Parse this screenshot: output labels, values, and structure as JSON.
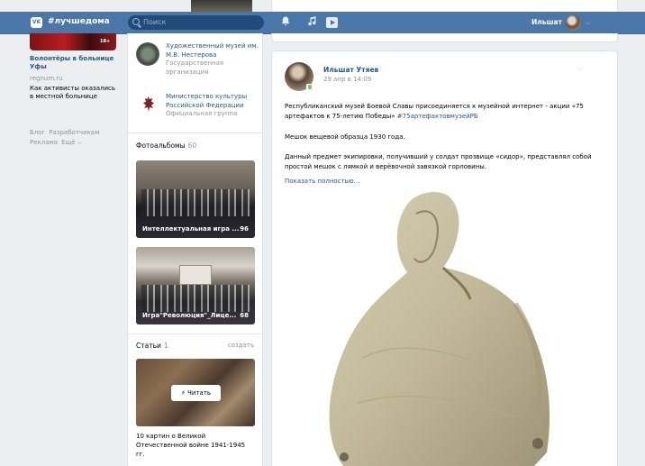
{
  "topbar": {
    "logo": "VK",
    "hashtag": "#лучшедома",
    "search_placeholder": "Поиск",
    "user_name": "Ильшат",
    "bell_icon": "bell-icon",
    "music_icon": "music-note-icon",
    "video_icon": "play-icon"
  },
  "left": {
    "badge": "18+",
    "ad_title": "Волонтёры в больнице Уфы",
    "ad_domain": "regnum.ru",
    "ad_desc": "Как активисты оказались в местной больнице",
    "footer": [
      "Блог",
      "Разработчикам",
      "Реклама",
      "Ещё ⌵"
    ]
  },
  "middle": {
    "groups": [
      {
        "name": "Художественный музей им. М.В. Нестерова",
        "sub": "Государственная организация"
      },
      {
        "name": "Министерство культуры Российской Федерации",
        "sub": "Официальная группа"
      }
    ],
    "albums_title": "Фотоальбомы",
    "albums_count": "60",
    "albums": [
      {
        "caption": "Интеллектуальная игра ...",
        "count": "96"
      },
      {
        "caption": "Игра\"Революция\"_Лице...",
        "count": "68"
      }
    ],
    "articles_title": "Статьи",
    "articles_count": "1",
    "articles_create": "создать",
    "read_button": "⚡ Читать",
    "article_title": "10 картин о Великой Отечественной войне 1941-1945 гг."
  },
  "post": {
    "author": "Ильшат Утяев",
    "date": "29 апр в 14:09",
    "p1": "Республиканский музей Боевой Славы присоединяется к музейной интернет - акции «75 артефактов к 75-летию Победы»",
    "p1_tag": "#75артефактовмузейРБ",
    "p2": "Мешок вещевой образца 1930 года.",
    "p3": "Данный предмет экипировки, получивший у солдат прозвище «сидор», представлял собой простой мешок с лямкой и верёвочной завязкой горловины.",
    "more": "Показать полностью…"
  }
}
